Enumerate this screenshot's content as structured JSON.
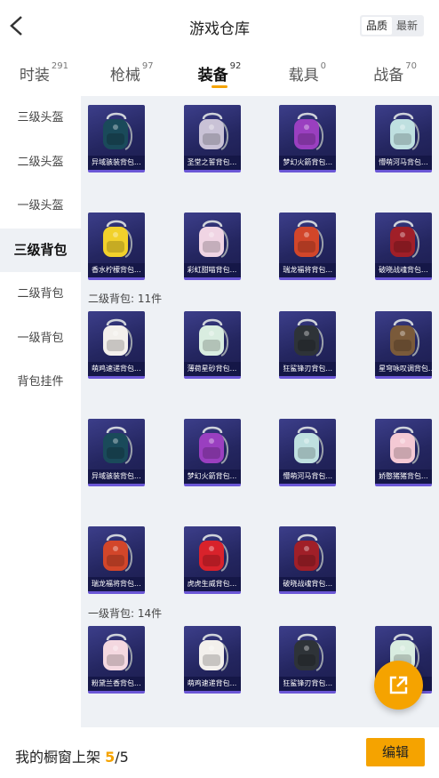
{
  "header": {
    "title": "游戏仓库",
    "sort": {
      "quality": "品质",
      "newest": "最新",
      "active": "quality"
    }
  },
  "tabs": [
    {
      "label": "时装",
      "count": "291",
      "active": false
    },
    {
      "label": "枪械",
      "count": "97",
      "active": false
    },
    {
      "label": "装备",
      "count": "92",
      "active": true
    },
    {
      "label": "载具",
      "count": "0",
      "active": false
    },
    {
      "label": "战备",
      "count": "70",
      "active": false
    }
  ],
  "sidebar": [
    {
      "label": "三级头盔",
      "active": false
    },
    {
      "label": "二级头盔",
      "active": false
    },
    {
      "label": "一级头盔",
      "active": false
    },
    {
      "label": "三级背包",
      "active": true
    },
    {
      "label": "二级背包",
      "active": false
    },
    {
      "label": "一级背包",
      "active": false
    },
    {
      "label": "背包挂件",
      "active": false
    }
  ],
  "sections": {
    "level3": {
      "label": "",
      "items": [
        {
          "name": "异域骇装背包...",
          "icon": "backpack-dark-icon",
          "color": "#1a4a5a"
        },
        {
          "name": "圣堂之誓背包...",
          "icon": "backpack-white-wings-icon",
          "color": "#c9c2d6"
        },
        {
          "name": "梦幻火箭背包...",
          "icon": "backpack-purple-rocket-icon",
          "color": "#9a3fc0"
        },
        {
          "name": "懵萌河马背包...",
          "icon": "backpack-hippo-icon",
          "color": "#bfe0e0"
        },
        {
          "name": "香水柠檬背包...",
          "icon": "backpack-lemon-icon",
          "color": "#f2d12b"
        },
        {
          "name": "彩虹甜喵背包...",
          "icon": "backpack-cat-icon",
          "color": "#f0d5e4"
        },
        {
          "name": "瑞龙福将背包...",
          "icon": "backpack-dragon-icon",
          "color": "#d2462a"
        },
        {
          "name": "破晓战魂背包...",
          "icon": "backpack-warrior-icon",
          "color": "#a01f28"
        }
      ]
    },
    "level2": {
      "label": "二级背包: 11件",
      "items": [
        {
          "name": "萌鸡速递背包...",
          "icon": "backpack-chick-icon",
          "color": "#f3f0ec"
        },
        {
          "name": "薄荷星砂背包...",
          "icon": "backpack-mint-icon",
          "color": "#d9ede0"
        },
        {
          "name": "狂鲨锋刃背包...",
          "icon": "backpack-shark-icon",
          "color": "#2e3338"
        },
        {
          "name": "星穹咏叹调背包...",
          "icon": "backpack-star-icon",
          "color": "#7a5a3a"
        },
        {
          "name": "异域骇装背包...",
          "icon": "backpack-dark-icon",
          "color": "#1a4a5a"
        },
        {
          "name": "梦幻火箭背包...",
          "icon": "backpack-purple-rocket-icon",
          "color": "#9a3fc0"
        },
        {
          "name": "懵萌河马背包...",
          "icon": "backpack-hippo-icon",
          "color": "#bfe0e0"
        },
        {
          "name": "娇憨猪猪背包...",
          "icon": "backpack-pig-icon",
          "color": "#f4c9d4"
        },
        {
          "name": "瑞龙福将背包...",
          "icon": "backpack-dragon-icon",
          "color": "#d2462a"
        },
        {
          "name": "虎虎生威背包...",
          "icon": "backpack-tiger-icon",
          "color": "#d8222b"
        },
        {
          "name": "破晓战魂背包...",
          "icon": "backpack-warrior-icon",
          "color": "#a01f28"
        }
      ]
    },
    "level1": {
      "label": "一级背包: 14件",
      "items": [
        {
          "name": "粉黛兰香背包...",
          "icon": "backpack-bunny-icon",
          "color": "#f4d8e0"
        },
        {
          "name": "萌鸡速递背包...",
          "icon": "backpack-chick-icon",
          "color": "#f3f0ec"
        },
        {
          "name": "狂鲨锋刃背包...",
          "icon": "backpack-shark-icon",
          "color": "#2e3338"
        },
        {
          "name": "....",
          "icon": "backpack-mint-icon",
          "color": "#d9ede0"
        }
      ]
    }
  },
  "footer": {
    "label": "我的橱窗上架",
    "current": "5",
    "total": "/5",
    "edit": "编辑"
  },
  "colors": {
    "accent": "#f5a300",
    "card_bg": "#242660",
    "card_border": "#6b57d6",
    "panel_bg": "#eef1f5"
  }
}
